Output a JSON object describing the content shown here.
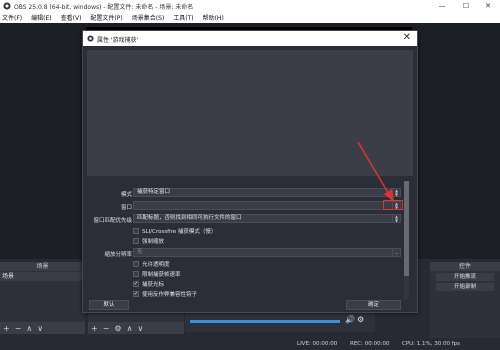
{
  "window": {
    "title": "OBS 25.0.8 (64-bit, windows) - 配置文件: 未命名 - 场景: 未命名",
    "minimize": "—",
    "maximize": "☐",
    "close": "✕"
  },
  "menu": [
    "文件(F)",
    "编辑(E)",
    "查看(V)",
    "配置文件(P)",
    "场景集合(S)",
    "工具(T)",
    "帮助(H)"
  ],
  "docks": {
    "scenes_title": "场景",
    "scene_item": "场景",
    "controls_title": "控件",
    "start_stream": "开始推流",
    "start_record": "开始录制"
  },
  "status": {
    "live": "LIVE: 00:00:00",
    "rec": "REC: 00:00:00",
    "cpu": "CPU: 1.1%, 30.00 fps"
  },
  "dialog": {
    "title": "属性 '游戏捕获'",
    "close": "✕",
    "mode_label": "模式",
    "mode_value": "捕获特定窗口",
    "window_label": "窗口",
    "window_value": "",
    "priority_label": "窗口匹配优先级",
    "priority_value": "匹配标题，否则找到相同可执行文件的窗口",
    "sli_label": "SLI/Crossfire 捕获模式（慢）",
    "force_scale_label": "强制缩放",
    "scale_res_label": "缩放分辨率",
    "scale_res_value": "无",
    "allow_transparency_label": "允许透明度",
    "limit_framerate_label": "限制捕获帧速率",
    "capture_cursor_label": "捕获光标",
    "anti_cheat_label": "使用反作弊兼容性钩子",
    "defaults_button": "默认",
    "ok_button": "确定",
    "capture_cursor_checked": true,
    "anti_cheat_checked": true
  },
  "colors": {
    "annotation": "#e0332b",
    "accent": "#3b8fdd"
  }
}
